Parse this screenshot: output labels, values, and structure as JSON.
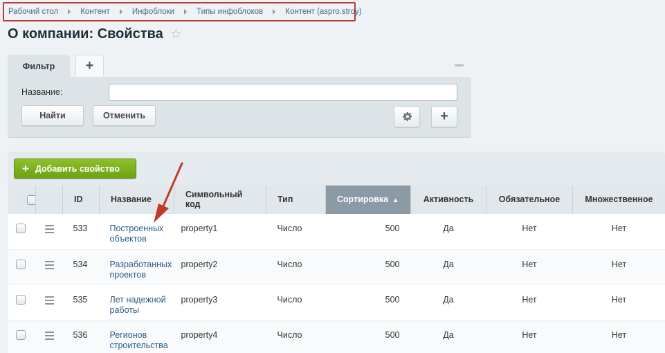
{
  "breadcrumb": [
    "Рабочий стол",
    "Контент",
    "Инфоблоки",
    "Типы инфоблоков",
    "Контент (aspro.stroy)"
  ],
  "page_title": "О компании: Свойства",
  "filter": {
    "tab_label": "Фильтр",
    "add_tab_symbol": "+",
    "name_label": "Название:",
    "name_value": "",
    "find_label": "Найти",
    "cancel_label": "Отменить"
  },
  "toolbar": {
    "add_property_label": "Добавить свойство"
  },
  "table": {
    "headers": {
      "id": "ID",
      "name": "Название",
      "code": "Символьный код",
      "type": "Тип",
      "sort": "Сортировка",
      "active": "Активность",
      "required": "Обязательное",
      "multiple": "Множественное"
    },
    "rows": [
      {
        "id": "533",
        "name": "Построенных объектов",
        "code": "property1",
        "type": "Число",
        "sort": "500",
        "active": "Да",
        "required": "Нет",
        "multiple": "Нет"
      },
      {
        "id": "534",
        "name": "Разработанных проектов",
        "code": "property2",
        "type": "Число",
        "sort": "500",
        "active": "Да",
        "required": "Нет",
        "multiple": "Нет"
      },
      {
        "id": "535",
        "name": "Лет надежной работы",
        "code": "property3",
        "type": "Число",
        "sort": "500",
        "active": "Да",
        "required": "Нет",
        "multiple": "Нет"
      },
      {
        "id": "536",
        "name": "Регионов строительства",
        "code": "property4",
        "type": "Число",
        "sort": "500",
        "active": "Да",
        "required": "Нет",
        "multiple": "Нет"
      }
    ]
  },
  "colors": {
    "highlight_border": "#b83a3a",
    "add_button": "#7cb01f",
    "sorted_header": "#8b9ba6",
    "link": "#2a5a8c"
  },
  "icons": [
    "chevron-right-icon",
    "star-icon",
    "plus-icon",
    "gear-icon",
    "hamburger-menu-icon",
    "sort-asc-icon",
    "red-arrow-annotation"
  ]
}
